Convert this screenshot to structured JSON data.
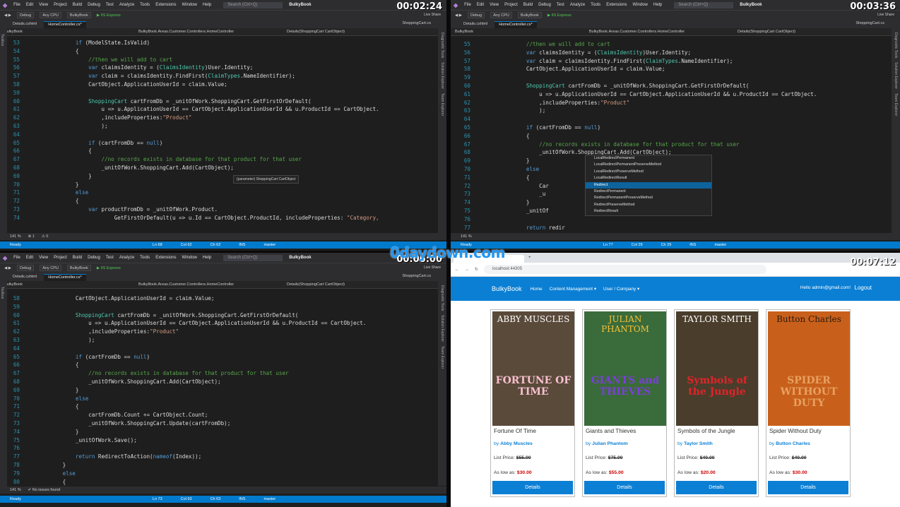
{
  "menu": [
    "File",
    "Edit",
    "View",
    "Project",
    "Build",
    "Debug",
    "Test",
    "Analyze",
    "Tools",
    "Extensions",
    "Window",
    "Help"
  ],
  "search_placeholder": "Search (Ctrl+Q)",
  "solution": "BulkyBook",
  "toolbar": {
    "config": "Debug",
    "platform": "Any CPU",
    "project": "BulkyBook",
    "run": "IIS Express"
  },
  "liveshare": "Live Share",
  "tabs": {
    "details": "Details.cshtml",
    "controller": "HomeController.cs*",
    "cart": "ShoppingCart.cs"
  },
  "nav": {
    "project": "BulkyBook",
    "class": "BulkyBook.Areas.Customer.Controllers.HomeController",
    "method": "Details(ShoppingCart CartObject)"
  },
  "side": {
    "toolbox": "Toolbox",
    "diag": "Diagnostic Tools",
    "solexp": "Solution Explorer",
    "team": "Team Explorer"
  },
  "p1": {
    "time": "00:02:24",
    "zoom": "141 %",
    "errors": "1",
    "warn": "0",
    "status": "Ready",
    "ln": "Ln 68",
    "col": "Col 62",
    "ch": "Ch 62",
    "ins": "INS",
    "up": "61",
    "pen": "2",
    "branch": "master",
    "tooltip": "(parameter) ShoppingCart CartObject",
    "lines": [
      {
        "n": "53",
        "h": "            <k>if</k> (ModelState.IsValid)"
      },
      {
        "n": "54",
        "h": "            {"
      },
      {
        "n": "55",
        "h": "                <c>//then we will add to cart</c>"
      },
      {
        "n": "56",
        "h": "                <k>var</k> claimsIdentity = (<t>ClaimsIdentity</t>)User.Identity;"
      },
      {
        "n": "57",
        "h": "                <k>var</k> claim = claimsIdentity.FindFirst(<t>ClaimTypes</t>.NameIdentifier);"
      },
      {
        "n": "58",
        "h": "                CartObject.ApplicationUserId = claim.Value;"
      },
      {
        "n": "59",
        "h": ""
      },
      {
        "n": "60",
        "h": "                <t>ShoppingCart</t> cartFromDb = _unitOfWork.ShoppingCart.GetFirstOrDefault("
      },
      {
        "n": "61",
        "h": "                    u => u.ApplicationUserId == CartObject.ApplicationUserId && u.ProductId == CartObject."
      },
      {
        "n": "62",
        "h": "                    ,includeProperties:<s>\"Product\"</s>"
      },
      {
        "n": "63",
        "h": "                    );"
      },
      {
        "n": "64",
        "h": ""
      },
      {
        "n": "65",
        "h": "                <k>if</k> (cartFromDb == <k>null</k>)"
      },
      {
        "n": "66",
        "h": "                {"
      },
      {
        "n": "67",
        "h": "                    <c>//no records exists in database for that product for that user</c>"
      },
      {
        "n": "68",
        "h": "                    _unitOfWork.ShoppingCart.Add(CartObject);"
      },
      {
        "n": "69",
        "h": "                }"
      },
      {
        "n": "70",
        "h": "            }"
      },
      {
        "n": "71",
        "h": "            <k>else</k>"
      },
      {
        "n": "72",
        "h": "            {"
      },
      {
        "n": "73",
        "h": "                <k>var</k> productFromDb = _unitOfWork.Product."
      },
      {
        "n": "74",
        "h": "                        GetFirstOrDefault(u => u.Id == CartObject.ProductId, includeProperties: <s>\"Category,</s>"
      }
    ]
  },
  "p2": {
    "time": "00:03:36",
    "zoom": "141 %",
    "status": "Ready",
    "ln": "Ln 77",
    "col": "Col 29",
    "ch": "Ch 29",
    "ins": "INS",
    "up": "61",
    "pen": "2",
    "branch": "master",
    "autocomplete": [
      "LocalRedirectPermanent",
      "LocalRedirectPermanentPreserveMethod",
      "LocalRedirectPreserveMethod",
      "LocalRedirectResult",
      "Redirect",
      "RedirectPermanent",
      "RedirectPermanentPreserveMethod",
      "RedirectPreserveMethod",
      "RedirectResult"
    ],
    "lines": [
      {
        "n": "55",
        "h": "            <c>//then we will add to cart</c>"
      },
      {
        "n": "56",
        "h": "            <k>var</k> claimsIdentity = (<t>ClaimsIdentity</t>)User.Identity;"
      },
      {
        "n": "57",
        "h": "            <k>var</k> claim = claimsIdentity.FindFirst(<t>ClaimTypes</t>.NameIdentifier);"
      },
      {
        "n": "58",
        "h": "            CartObject.ApplicationUserId = claim.Value;"
      },
      {
        "n": "59",
        "h": ""
      },
      {
        "n": "60",
        "h": "            <t>ShoppingCart</t> cartFromDb = _unitOfWork.ShoppingCart.GetFirstOrDefault("
      },
      {
        "n": "61",
        "h": "                u => u.ApplicationUserId == CartObject.ApplicationUserId && u.ProductId == CartObject."
      },
      {
        "n": "62",
        "h": "                ,includeProperties:<s>\"Product\"</s>"
      },
      {
        "n": "63",
        "h": "                );"
      },
      {
        "n": "64",
        "h": ""
      },
      {
        "n": "65",
        "h": "            <k>if</k> (cartFromDb == <k>null</k>)"
      },
      {
        "n": "66",
        "h": "            {"
      },
      {
        "n": "67",
        "h": "                <c>//no records exists in database for that product for that user</c>"
      },
      {
        "n": "68",
        "h": "                _unitOfWork.ShoppingCart.Add(CartObject);"
      },
      {
        "n": "69",
        "h": "            }"
      },
      {
        "n": "70",
        "h": "            <k>else</k>"
      },
      {
        "n": "71",
        "h": "            {"
      },
      {
        "n": "72",
        "h": "                Car"
      },
      {
        "n": "73",
        "h": "                _u                                           bject);"
      },
      {
        "n": "74",
        "h": "            }"
      },
      {
        "n": "75",
        "h": "            _unitOf"
      },
      {
        "n": "76",
        "h": ""
      },
      {
        "n": "77",
        "h": "            <k>return</k> redir"
      }
    ]
  },
  "p3": {
    "time": "00:06:00",
    "zoom": "141 %",
    "issues": "No issues found",
    "status": "Ready",
    "ln": "Ln 73",
    "col": "Col 63",
    "ch": "Ch 63",
    "ins": "INS",
    "up": "61",
    "pen": "2",
    "branch": "master",
    "lines": [
      {
        "n": "58",
        "h": "            CartObject.ApplicationUserId = claim.Value;"
      },
      {
        "n": "59",
        "h": ""
      },
      {
        "n": "60",
        "h": "            <t>ShoppingCart</t> cartFromDb = _unitOfWork.ShoppingCart.GetFirstOrDefault("
      },
      {
        "n": "61",
        "h": "                u => u.ApplicationUserId == CartObject.ApplicationUserId && u.ProductId == CartObject."
      },
      {
        "n": "62",
        "h": "                ,includeProperties:<s>\"Product\"</s>"
      },
      {
        "n": "63",
        "h": "                );"
      },
      {
        "n": "64",
        "h": ""
      },
      {
        "n": "65",
        "h": "            <k>if</k> (cartFromDb == <k>null</k>)"
      },
      {
        "n": "66",
        "h": "            {"
      },
      {
        "n": "67",
        "h": "                <c>//no records exists in database for that product for that user</c>"
      },
      {
        "n": "68",
        "h": "                _unitOfWork.ShoppingCart.Add(CartObject);"
      },
      {
        "n": "69",
        "h": "            }"
      },
      {
        "n": "70",
        "h": "            <k>else</k>"
      },
      {
        "n": "71",
        "h": "            {"
      },
      {
        "n": "72",
        "h": "                cartFromDb.Count += CartObject.Count;"
      },
      {
        "n": "73",
        "h": "                _unitOfWork.ShoppingCart.Update(cartFromDb);"
      },
      {
        "n": "74",
        "h": "            }"
      },
      {
        "n": "75",
        "h": "            _unitOfWork.Save();"
      },
      {
        "n": "76",
        "h": ""
      },
      {
        "n": "77",
        "h": "            <k>return</k> RedirectToAction(<k>nameof</k>(Index));"
      },
      {
        "n": "78",
        "h": "        }"
      },
      {
        "n": "79",
        "h": "        <k>else</k>"
      },
      {
        "n": "80",
        "h": "        {"
      }
    ]
  },
  "p4": {
    "time": "00:07:12",
    "url": "localhost:44305",
    "brand": "BulkyBook",
    "nav": [
      "Home",
      "Content Management ▾",
      "User / Company ▾"
    ],
    "hello": "Hello admin@gmail.com!",
    "logout": "Logout",
    "books": [
      {
        "title": "Fortune Of Time",
        "author": "Abby Muscles",
        "list": "$55.00",
        "low": "$30.00",
        "cover_top": "ABBY MUSCLES",
        "cover_mid": "FORTUNE OF TIME",
        "bg": "#5a4a3a",
        "top_color": "#ffffff",
        "mid_color": "#f7c0d0"
      },
      {
        "title": "Giants and Thieves",
        "author": "Julian Phantom",
        "list": "$75.00",
        "low": "$55.00",
        "cover_top": "JULIAN PHANTOM",
        "cover_mid": "GIANTS and THIEVES",
        "bg": "#3a6b3a",
        "top_color": "#f5c13a",
        "mid_color": "#7b3fd8"
      },
      {
        "title": "Symbols of the Jungle",
        "author": "Taylor Smith",
        "list": "$40.00",
        "low": "$20.00",
        "cover_top": "TAYLOR SMITH",
        "cover_mid": "Symbols of the Jungle",
        "bg": "#4a3d2b",
        "top_color": "#ffffff",
        "mid_color": "#e0242a"
      },
      {
        "title": "Spider Without Duty",
        "author": "Button Charles",
        "list": "$40.00",
        "low": "$30.00",
        "cover_top": "Button Charles",
        "cover_mid": "SPIDER WITHOUT DUTY",
        "bg": "#c8601c",
        "top_color": "#2b1a0a",
        "mid_color": "#e8a060"
      }
    ],
    "by": "by",
    "list_label": "List Price:",
    "low_label": "As low as:",
    "details": "Details"
  },
  "watermark": "0daydown.com"
}
